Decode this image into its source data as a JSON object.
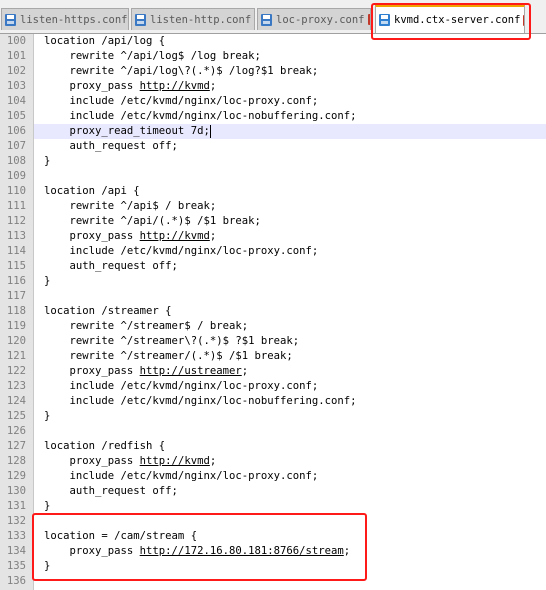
{
  "tabs": [
    {
      "label": "listen-https.conf",
      "icon": "file-icon",
      "active": false
    },
    {
      "label": "listen-http.conf",
      "icon": "file-icon",
      "active": false
    },
    {
      "label": "loc-proxy.conf",
      "icon": "file-icon",
      "active": false
    },
    {
      "label": "kvmd.ctx-server.conf",
      "icon": "file-icon",
      "active": true
    }
  ],
  "editor": {
    "highlighted_line": 106,
    "lines": [
      {
        "num": "100",
        "text": "location /api/log {"
      },
      {
        "num": "101",
        "text": "    rewrite ^/api/log$ /log break;"
      },
      {
        "num": "102",
        "text": "    rewrite ^/api/log\\?(.*)$ /log?$1 break;"
      },
      {
        "num": "103",
        "text": "    proxy_pass ",
        "link": "http://kvmd",
        "after": ";"
      },
      {
        "num": "104",
        "text": "    include /etc/kvmd/nginx/loc-proxy.conf;"
      },
      {
        "num": "105",
        "text": "    include /etc/kvmd/nginx/loc-nobuffering.conf;"
      },
      {
        "num": "106",
        "text": "    proxy_read_timeout 7d;"
      },
      {
        "num": "107",
        "text": "    auth_request off;"
      },
      {
        "num": "108",
        "text": "}"
      },
      {
        "num": "109",
        "text": ""
      },
      {
        "num": "110",
        "text": "location /api {"
      },
      {
        "num": "111",
        "text": "    rewrite ^/api$ / break;"
      },
      {
        "num": "112",
        "text": "    rewrite ^/api/(.*)$ /$1 break;"
      },
      {
        "num": "113",
        "text": "    proxy_pass ",
        "link": "http://kvmd",
        "after": ";"
      },
      {
        "num": "114",
        "text": "    include /etc/kvmd/nginx/loc-proxy.conf;"
      },
      {
        "num": "115",
        "text": "    auth_request off;"
      },
      {
        "num": "116",
        "text": "}"
      },
      {
        "num": "117",
        "text": ""
      },
      {
        "num": "118",
        "text": "location /streamer {"
      },
      {
        "num": "119",
        "text": "    rewrite ^/streamer$ / break;"
      },
      {
        "num": "120",
        "text": "    rewrite ^/streamer\\?(.*)$ ?$1 break;"
      },
      {
        "num": "121",
        "text": "    rewrite ^/streamer/(.*)$ /$1 break;"
      },
      {
        "num": "122",
        "text": "    proxy_pass ",
        "link": "http://ustreamer",
        "after": ";"
      },
      {
        "num": "123",
        "text": "    include /etc/kvmd/nginx/loc-proxy.conf;"
      },
      {
        "num": "124",
        "text": "    include /etc/kvmd/nginx/loc-nobuffering.conf;"
      },
      {
        "num": "125",
        "text": "}"
      },
      {
        "num": "126",
        "text": ""
      },
      {
        "num": "127",
        "text": "location /redfish {"
      },
      {
        "num": "128",
        "text": "    proxy_pass ",
        "link": "http://kvmd",
        "after": ";"
      },
      {
        "num": "129",
        "text": "    include /etc/kvmd/nginx/loc-proxy.conf;"
      },
      {
        "num": "130",
        "text": "    auth_request off;"
      },
      {
        "num": "131",
        "text": "}"
      },
      {
        "num": "132",
        "text": ""
      },
      {
        "num": "133",
        "text": "location = /cam/stream {"
      },
      {
        "num": "134",
        "text": "    proxy_pass ",
        "link": "http://172.16.80.181:8766/stream",
        "after": ";"
      },
      {
        "num": "135",
        "text": "}"
      },
      {
        "num": "136",
        "text": ""
      }
    ]
  },
  "colors": {
    "annotation_box": "#ff1a1a",
    "tab_icon_inactive": "#3b78c4",
    "tab_icon_active": "#2f80d0",
    "highlight_line_bg": "#e8e8ff"
  }
}
